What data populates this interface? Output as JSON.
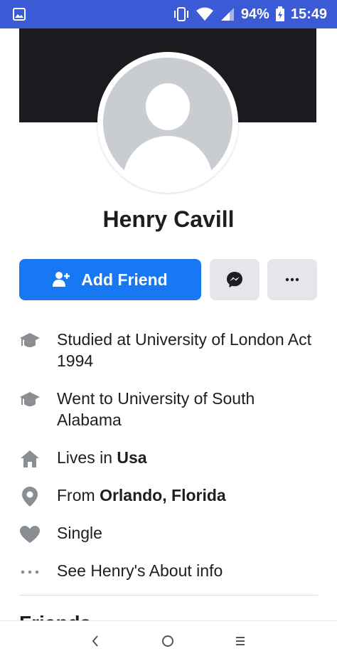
{
  "status_bar": {
    "battery": "94%",
    "time": "15:49",
    "icons": [
      "gallery-icon",
      "vibrate-icon",
      "wifi-icon",
      "signal-icon",
      "battery-charging-icon"
    ]
  },
  "profile": {
    "name": "Henry Cavill"
  },
  "actions": {
    "add_friend_label": "Add Friend",
    "messenger_icon": "messenger-icon",
    "more_icon": "more-icon"
  },
  "info": [
    {
      "icon": "graduation-cap-icon",
      "prefix": "Studied at University of London Act 1994",
      "bold": ""
    },
    {
      "icon": "graduation-cap-icon",
      "prefix": "Went to University of South Alabama",
      "bold": ""
    },
    {
      "icon": "home-icon",
      "prefix": "Lives in ",
      "bold": "Usa"
    },
    {
      "icon": "location-pin-icon",
      "prefix": "From ",
      "bold": "Orlando, Florida"
    },
    {
      "icon": "heart-icon",
      "prefix": "Single",
      "bold": ""
    },
    {
      "icon": "more-dots-icon",
      "prefix": "See Henry's About info",
      "bold": ""
    }
  ],
  "friends_section": {
    "title": "Friends"
  },
  "nav": {
    "back_icon": "back-icon",
    "home_icon": "home-circle-icon",
    "recents_icon": "recents-icon"
  }
}
